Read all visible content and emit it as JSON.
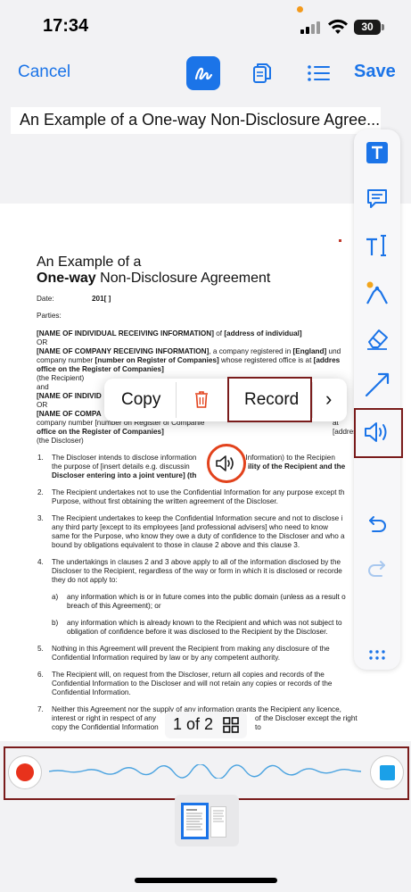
{
  "status_bar": {
    "time": "17:34",
    "battery": "30"
  },
  "toolbar": {
    "cancel_label": "Cancel",
    "save_label": "Save",
    "icons": [
      "sign-icon",
      "pages-icon",
      "list-icon"
    ]
  },
  "document_title": "An Example of a One-way Non-Disclosure Agree...",
  "document": {
    "heading_line1": "An Example of a",
    "heading_bold": "One-way",
    "heading_rest": " Non-Disclosure Agreement",
    "date_label": "Date:",
    "date_value": "201[ ]",
    "parties_label": "Parties:",
    "party1_bold": "[NAME OF INDIVIDUAL RECEIVING INFORMATION]",
    "party1_rest": " of ",
    "party1_bold2": "[address of individual]",
    "or1": "OR",
    "party2_bold": "[NAME OF COMPANY RECEIVING INFORMATION]",
    "party2_rest": ", a company registered in ",
    "party2_bold2": "[England]",
    "party2_rest2": " und",
    "party2_line2_a": "company number ",
    "party2_line2_bold": "[number on Register of Companies]",
    "party2_line2_b": " whose registered office is at ",
    "party2_line2_bold2": "[addres",
    "party2_line3_bold": "office on the Register of Companies]",
    "recipient": "(the Recipient)",
    "and": "and",
    "party3_bold": "[NAME OF INDIVID",
    "or2": "OR",
    "party4_bold": "[NAME OF COMPA",
    "party4_line2": "company number [number on Register of Companie",
    "party4_line2_end": "at [addres",
    "party4_line3_bold": "office on the Register of Companies]",
    "discloser": "(the Discloser)",
    "clauses": [
      {
        "n": "1.",
        "lines": [
          "The Discloser intends to disclose information",
          "ntial Information) to the Recipien",
          "the purpose of [insert details e.g. discussin",
          "ility of the Recipient and the",
          "Discloser entering into a joint venture] (th",
          "e"
        ]
      },
      {
        "n": "2.",
        "lines": [
          "The Recipient undertakes not to use the Confidential Information for any purpose except th",
          "Purpose, without first obtaining the written agreement of the Discloser."
        ]
      },
      {
        "n": "3.",
        "lines": [
          "The Recipient undertakes to keep the Confidential Information secure and not to disclose i",
          "any third party [except to its employees [and professional advisers] who need to know",
          "same for the Purpose, who know they owe a duty of confidence to the Discloser and who a",
          "bound by obligations equivalent to those in clause 2 above and this clause 3."
        ]
      },
      {
        "n": "4.",
        "lines": [
          "The undertakings in clauses 2 and 3 above apply to all of the information disclosed by the",
          "Discloser to the Recipient, regardless of the way or form in which it is disclosed or recorde",
          "they do not apply to:"
        ]
      },
      {
        "n": "5.",
        "lines": [
          "Nothing in this Agreement will prevent the Recipient from making any disclosure of the",
          "Confidential Information required by law or by any competent authority."
        ]
      },
      {
        "n": "6.",
        "lines": [
          "The Recipient will, on request from the Discloser, return all copies and records of the",
          "Confidential Information to the Discloser and will not retain any copies or records of the",
          "Confidential Information."
        ]
      },
      {
        "n": "7.",
        "lines": [
          "Neither this Agreement nor the supply of any information grants the Recipient any licence,",
          "interest or right in respect of any",
          "of the Discloser except the right to",
          "copy the Confidential Information"
        ]
      }
    ],
    "sub_a_label": "a)",
    "sub_a_lines": [
      "any information which is or in future comes into the public domain (unless as a result o",
      "breach of this Agreement); or"
    ],
    "sub_b_label": "b)",
    "sub_b_lines": [
      "any information which is already known to the Recipient and which was not subject to",
      "obligation of confidence before it was disclosed to the Recipient by the Discloser."
    ]
  },
  "context_menu": {
    "copy_label": "Copy",
    "record_label": "Record",
    "more_label": "›"
  },
  "page_indicator": {
    "text": "1 of 2"
  },
  "palette_tools": [
    "text-box-icon",
    "comment-icon",
    "text-cursor-icon",
    "pen-icon",
    "eraser-icon",
    "line-icon",
    "audio-icon",
    "undo-icon",
    "redo-icon",
    "more-icon"
  ],
  "colors": {
    "accent": "#1b74e8",
    "highlight_border": "#7a1c1c",
    "record_red": "#e8321c",
    "stop_blue": "#1ba0e8",
    "waveform": "#4aa3e0"
  }
}
